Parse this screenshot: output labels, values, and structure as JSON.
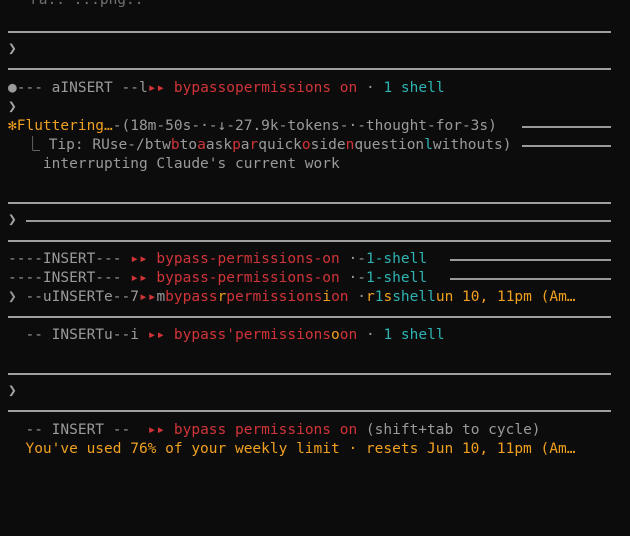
{
  "top_clipped": "ra..      ...png..",
  "prompt_char": "❯",
  "rows": {
    "r1": {
      "a": "●--- a",
      "b": "INSERT --l",
      "c": "▸▸ ",
      "d": "bypass",
      "e": "o",
      "f": "permissions on",
      "g": " · ",
      "h": "1 shell"
    },
    "r2_prompt": "❯",
    "fluttering": {
      "icon": "✻",
      "word": "Fluttering…",
      "meta": "-(18m-50s-·-↓-27.9k-tokens-·-thought-for-3s)"
    },
    "tip": {
      "lead": "  ⎿ Tip: ",
      "t1": "R",
      "t2": "Use-/btw",
      "t3": "b",
      "t4": "to",
      "t5": "a",
      "t6": "ask",
      "t7": "p",
      "t8": "a",
      "t9": "r",
      "t10": "quick",
      "t11": "o",
      "t12": "side",
      "t13": "n",
      "t14": "question",
      "t15": "l",
      "t16": "without",
      "t17": "s)"
    },
    "tip2": "    interrupting Claude's current work",
    "prompt3": "❯",
    "insert1": {
      "a": "----INSERT--- ",
      "b": "▸▸ ",
      "c": "bypass-permissions-on",
      "d": " ·-",
      "e": "1",
      "f": "-shell"
    },
    "insert2": {
      "a": "----INSERT--- ",
      "b": "▸▸ ",
      "c": "bypass-permissions-on",
      "d": " ·-",
      "e": "1",
      "f": "-shell"
    },
    "insert3": {
      "a": "❯ --u",
      "b": "INSERT",
      "c": "e--7",
      "d": "▸▸",
      "e": "m",
      "f": "bypass",
      "g": "r",
      "h": "permissions",
      "i": "i",
      "j": "on ",
      "k": "·",
      "l": "r",
      "m": "1",
      "n": "s",
      "o": "shell",
      "p": "un 10, 11pm (Am…"
    },
    "insert4": {
      "a": "  -- INSERT",
      "b": "u--i",
      "c": " ▸▸ ",
      "d": "bypass",
      "e": "'",
      "f": "permissions",
      "g": "o",
      "h": "on",
      "i": " · ",
      "j": "1 shell"
    },
    "prompt5": "❯",
    "final": {
      "a": "  -- INSERT -- ",
      "b": " ▸▸ ",
      "c": "bypass permissions on",
      "d": " (shift+tab to cycle)"
    },
    "weekly": "  You've used 76% of your weekly limit · resets Jun 10, 11pm (Am…"
  }
}
